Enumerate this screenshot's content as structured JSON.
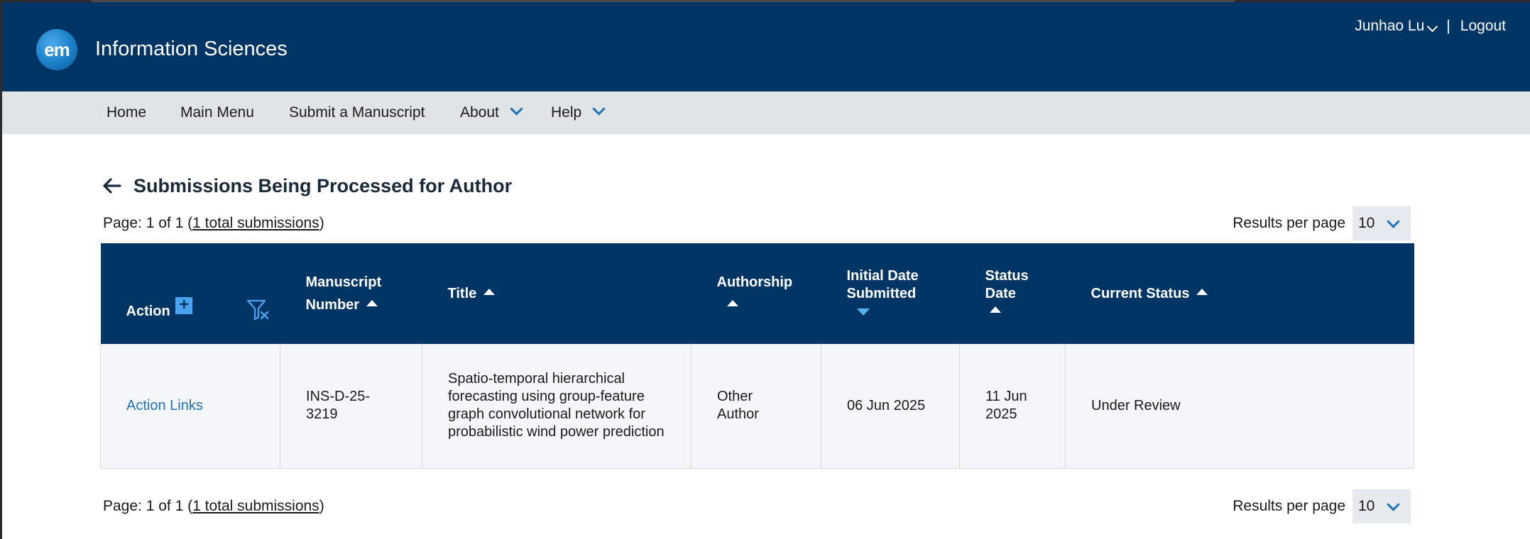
{
  "header": {
    "logo_text": "em",
    "journal_name": "Information Sciences",
    "user_name": "Junhao Lu",
    "separator": "|",
    "logout_label": "Logout"
  },
  "nav": {
    "items": [
      {
        "label": "Home"
      },
      {
        "label": "Main Menu"
      },
      {
        "label": "Submit a Manuscript"
      },
      {
        "label": "About"
      },
      {
        "label": "Help"
      }
    ]
  },
  "page": {
    "title": "Submissions Being Processed for Author"
  },
  "pager_top": {
    "prefix": "Page: 1 of 1 (",
    "link": "1 total submissions",
    "suffix": ")",
    "rpp_label": "Results per page",
    "rpp_value": "10"
  },
  "pager_bottom": {
    "prefix": "Page: 1 of 1 (",
    "link": "1 total submissions",
    "suffix": ")",
    "rpp_label": "Results per page",
    "rpp_value": "10"
  },
  "table": {
    "headers": {
      "action": "Action",
      "manuscript_1": "Manuscript",
      "manuscript_2": "Number",
      "title": "Title",
      "authorship": "Authorship",
      "initial_1": "Initial Date",
      "initial_2": "Submitted",
      "status_1": "Status",
      "status_2": "Date",
      "current_status": "Current Status"
    },
    "plus_symbol": "+",
    "rows": [
      {
        "action": "Action Links",
        "manuscript_number": "INS-D-25-3219",
        "title": "Spatio-temporal hierarchical forecasting using group-feature graph convolutional network for probabilistic wind power prediction",
        "authorship": "Other Author",
        "initial_date": "06 Jun 2025",
        "status_date": "11 Jun 2025",
        "current_status": "Under Review"
      }
    ]
  },
  "colors": {
    "header_bg": "#003565",
    "nav_bg": "#e1e4e7",
    "accent": "#1f73b7",
    "sort_active": "#4fb4f0",
    "row_bg": "#f4f6f9"
  },
  "icons": [
    "back-arrow-icon",
    "chevron-down-icon",
    "plus-icon",
    "clear-filter-icon",
    "sort-asc-icon",
    "sort-desc-icon"
  ]
}
